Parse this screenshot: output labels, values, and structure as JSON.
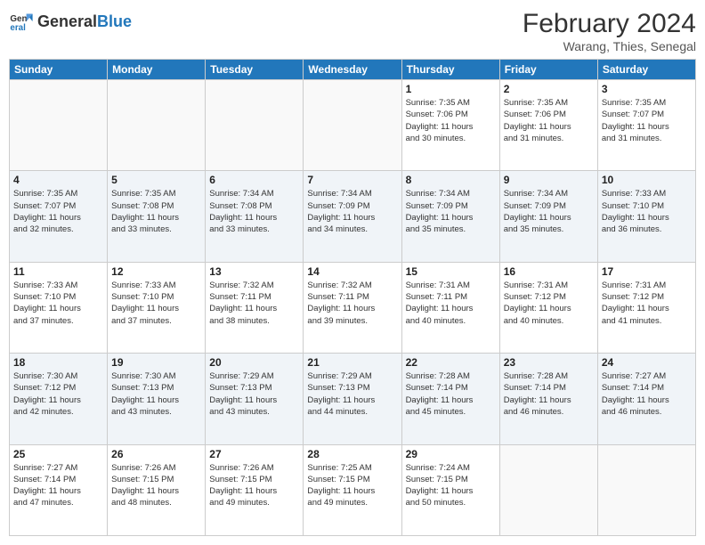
{
  "header": {
    "logo": {
      "text_general": "General",
      "text_blue": "Blue"
    },
    "title": "February 2024",
    "subtitle": "Warang, Thies, Senegal"
  },
  "weekdays": [
    "Sunday",
    "Monday",
    "Tuesday",
    "Wednesday",
    "Thursday",
    "Friday",
    "Saturday"
  ],
  "weeks": [
    [
      {
        "day": "",
        "info": ""
      },
      {
        "day": "",
        "info": ""
      },
      {
        "day": "",
        "info": ""
      },
      {
        "day": "",
        "info": ""
      },
      {
        "day": "1",
        "info": "Sunrise: 7:35 AM\nSunset: 7:06 PM\nDaylight: 11 hours\nand 30 minutes."
      },
      {
        "day": "2",
        "info": "Sunrise: 7:35 AM\nSunset: 7:06 PM\nDaylight: 11 hours\nand 31 minutes."
      },
      {
        "day": "3",
        "info": "Sunrise: 7:35 AM\nSunset: 7:07 PM\nDaylight: 11 hours\nand 31 minutes."
      }
    ],
    [
      {
        "day": "4",
        "info": "Sunrise: 7:35 AM\nSunset: 7:07 PM\nDaylight: 11 hours\nand 32 minutes."
      },
      {
        "day": "5",
        "info": "Sunrise: 7:35 AM\nSunset: 7:08 PM\nDaylight: 11 hours\nand 33 minutes."
      },
      {
        "day": "6",
        "info": "Sunrise: 7:34 AM\nSunset: 7:08 PM\nDaylight: 11 hours\nand 33 minutes."
      },
      {
        "day": "7",
        "info": "Sunrise: 7:34 AM\nSunset: 7:09 PM\nDaylight: 11 hours\nand 34 minutes."
      },
      {
        "day": "8",
        "info": "Sunrise: 7:34 AM\nSunset: 7:09 PM\nDaylight: 11 hours\nand 35 minutes."
      },
      {
        "day": "9",
        "info": "Sunrise: 7:34 AM\nSunset: 7:09 PM\nDaylight: 11 hours\nand 35 minutes."
      },
      {
        "day": "10",
        "info": "Sunrise: 7:33 AM\nSunset: 7:10 PM\nDaylight: 11 hours\nand 36 minutes."
      }
    ],
    [
      {
        "day": "11",
        "info": "Sunrise: 7:33 AM\nSunset: 7:10 PM\nDaylight: 11 hours\nand 37 minutes."
      },
      {
        "day": "12",
        "info": "Sunrise: 7:33 AM\nSunset: 7:10 PM\nDaylight: 11 hours\nand 37 minutes."
      },
      {
        "day": "13",
        "info": "Sunrise: 7:32 AM\nSunset: 7:11 PM\nDaylight: 11 hours\nand 38 minutes."
      },
      {
        "day": "14",
        "info": "Sunrise: 7:32 AM\nSunset: 7:11 PM\nDaylight: 11 hours\nand 39 minutes."
      },
      {
        "day": "15",
        "info": "Sunrise: 7:31 AM\nSunset: 7:11 PM\nDaylight: 11 hours\nand 40 minutes."
      },
      {
        "day": "16",
        "info": "Sunrise: 7:31 AM\nSunset: 7:12 PM\nDaylight: 11 hours\nand 40 minutes."
      },
      {
        "day": "17",
        "info": "Sunrise: 7:31 AM\nSunset: 7:12 PM\nDaylight: 11 hours\nand 41 minutes."
      }
    ],
    [
      {
        "day": "18",
        "info": "Sunrise: 7:30 AM\nSunset: 7:12 PM\nDaylight: 11 hours\nand 42 minutes."
      },
      {
        "day": "19",
        "info": "Sunrise: 7:30 AM\nSunset: 7:13 PM\nDaylight: 11 hours\nand 43 minutes."
      },
      {
        "day": "20",
        "info": "Sunrise: 7:29 AM\nSunset: 7:13 PM\nDaylight: 11 hours\nand 43 minutes."
      },
      {
        "day": "21",
        "info": "Sunrise: 7:29 AM\nSunset: 7:13 PM\nDaylight: 11 hours\nand 44 minutes."
      },
      {
        "day": "22",
        "info": "Sunrise: 7:28 AM\nSunset: 7:14 PM\nDaylight: 11 hours\nand 45 minutes."
      },
      {
        "day": "23",
        "info": "Sunrise: 7:28 AM\nSunset: 7:14 PM\nDaylight: 11 hours\nand 46 minutes."
      },
      {
        "day": "24",
        "info": "Sunrise: 7:27 AM\nSunset: 7:14 PM\nDaylight: 11 hours\nand 46 minutes."
      }
    ],
    [
      {
        "day": "25",
        "info": "Sunrise: 7:27 AM\nSunset: 7:14 PM\nDaylight: 11 hours\nand 47 minutes."
      },
      {
        "day": "26",
        "info": "Sunrise: 7:26 AM\nSunset: 7:15 PM\nDaylight: 11 hours\nand 48 minutes."
      },
      {
        "day": "27",
        "info": "Sunrise: 7:26 AM\nSunset: 7:15 PM\nDaylight: 11 hours\nand 49 minutes."
      },
      {
        "day": "28",
        "info": "Sunrise: 7:25 AM\nSunset: 7:15 PM\nDaylight: 11 hours\nand 49 minutes."
      },
      {
        "day": "29",
        "info": "Sunrise: 7:24 AM\nSunset: 7:15 PM\nDaylight: 11 hours\nand 50 minutes."
      },
      {
        "day": "",
        "info": ""
      },
      {
        "day": "",
        "info": ""
      }
    ]
  ]
}
